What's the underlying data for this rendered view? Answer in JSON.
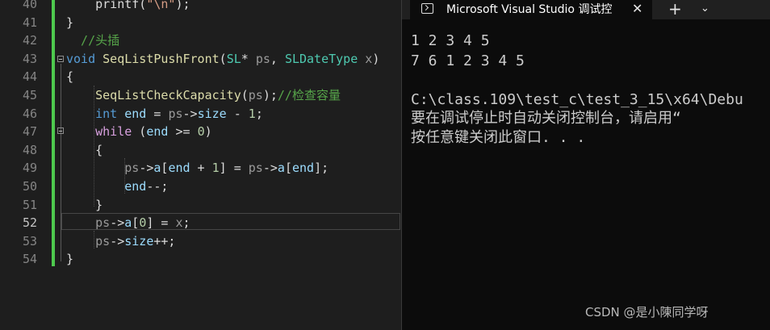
{
  "editor": {
    "lines": [
      {
        "num": "40",
        "tokens": [
          {
            "t": "    printf(",
            "c": "pl"
          },
          {
            "t": "\"\\n\"",
            "c": "st"
          },
          {
            "t": ");",
            "c": "pl"
          }
        ]
      },
      {
        "num": "41",
        "tokens": [
          {
            "t": "}",
            "c": "pl"
          }
        ]
      },
      {
        "num": "42",
        "tokens": [
          {
            "t": "  //头插",
            "c": "cm"
          }
        ]
      },
      {
        "num": "43",
        "tokens": [
          {
            "t": "void",
            "c": "kw"
          },
          {
            "t": " ",
            "c": "pl"
          },
          {
            "t": "SeqListPushFront",
            "c": "fn"
          },
          {
            "t": "(",
            "c": "pl"
          },
          {
            "t": "SL",
            "c": "ty"
          },
          {
            "t": "* ",
            "c": "pl"
          },
          {
            "t": "ps",
            "c": "pm"
          },
          {
            "t": ", ",
            "c": "pl"
          },
          {
            "t": "SLDateType",
            "c": "ty"
          },
          {
            "t": " ",
            "c": "pl"
          },
          {
            "t": "x",
            "c": "pm"
          },
          {
            "t": ")",
            "c": "pl"
          }
        ]
      },
      {
        "num": "44",
        "tokens": [
          {
            "t": "{",
            "c": "pl"
          }
        ]
      },
      {
        "num": "45",
        "tokens": [
          {
            "t": "    ",
            "c": "pl"
          },
          {
            "t": "SeqListCheckCapacity",
            "c": "fn"
          },
          {
            "t": "(",
            "c": "pl"
          },
          {
            "t": "ps",
            "c": "pm"
          },
          {
            "t": ");",
            "c": "pl"
          },
          {
            "t": "//检查容量",
            "c": "cm"
          }
        ]
      },
      {
        "num": "46",
        "tokens": [
          {
            "t": "    ",
            "c": "pl"
          },
          {
            "t": "int",
            "c": "kw"
          },
          {
            "t": " ",
            "c": "pl"
          },
          {
            "t": "end",
            "c": "var"
          },
          {
            "t": " = ",
            "c": "pl"
          },
          {
            "t": "ps",
            "c": "pm"
          },
          {
            "t": "->",
            "c": "pl"
          },
          {
            "t": "size",
            "c": "var"
          },
          {
            "t": " - ",
            "c": "pl"
          },
          {
            "t": "1",
            "c": "nm"
          },
          {
            "t": ";",
            "c": "pl"
          }
        ]
      },
      {
        "num": "47",
        "tokens": [
          {
            "t": "    ",
            "c": "pl"
          },
          {
            "t": "while",
            "c": "kw2"
          },
          {
            "t": " (",
            "c": "pl"
          },
          {
            "t": "end",
            "c": "var"
          },
          {
            "t": " >= ",
            "c": "pl"
          },
          {
            "t": "0",
            "c": "nm"
          },
          {
            "t": ")",
            "c": "pl"
          }
        ]
      },
      {
        "num": "48",
        "tokens": [
          {
            "t": "    {",
            "c": "pl"
          }
        ]
      },
      {
        "num": "49",
        "tokens": [
          {
            "t": "        ",
            "c": "pl"
          },
          {
            "t": "ps",
            "c": "pm"
          },
          {
            "t": "->",
            "c": "pl"
          },
          {
            "t": "a",
            "c": "var"
          },
          {
            "t": "[",
            "c": "pl"
          },
          {
            "t": "end",
            "c": "var"
          },
          {
            "t": " + ",
            "c": "pl"
          },
          {
            "t": "1",
            "c": "nm"
          },
          {
            "t": "] = ",
            "c": "pl"
          },
          {
            "t": "ps",
            "c": "pm"
          },
          {
            "t": "->",
            "c": "pl"
          },
          {
            "t": "a",
            "c": "var"
          },
          {
            "t": "[",
            "c": "pl"
          },
          {
            "t": "end",
            "c": "var"
          },
          {
            "t": "];",
            "c": "pl"
          }
        ]
      },
      {
        "num": "50",
        "tokens": [
          {
            "t": "        ",
            "c": "pl"
          },
          {
            "t": "end",
            "c": "var"
          },
          {
            "t": "--;",
            "c": "pl"
          }
        ]
      },
      {
        "num": "51",
        "tokens": [
          {
            "t": "    }",
            "c": "pl"
          }
        ]
      },
      {
        "num": "52",
        "tokens": [
          {
            "t": "    ",
            "c": "pl"
          },
          {
            "t": "ps",
            "c": "pm"
          },
          {
            "t": "->",
            "c": "pl"
          },
          {
            "t": "a",
            "c": "var"
          },
          {
            "t": "[",
            "c": "pl"
          },
          {
            "t": "0",
            "c": "nm"
          },
          {
            "t": "] = ",
            "c": "pl"
          },
          {
            "t": "x",
            "c": "pm"
          },
          {
            "t": ";",
            "c": "pl"
          }
        ]
      },
      {
        "num": "53",
        "tokens": [
          {
            "t": "    ",
            "c": "pl"
          },
          {
            "t": "ps",
            "c": "pm"
          },
          {
            "t": "->",
            "c": "pl"
          },
          {
            "t": "size",
            "c": "var"
          },
          {
            "t": "++;",
            "c": "pl"
          }
        ]
      },
      {
        "num": "54",
        "tokens": [
          {
            "t": "}",
            "c": "pl"
          }
        ]
      }
    ],
    "active_line": "52",
    "colors": {
      "change_bar": "#4ec94e",
      "background": "#1e1e1e"
    }
  },
  "terminal": {
    "tab_title": "Microsoft Visual Studio 调试控",
    "tab_close": "✕",
    "tab_add": "+",
    "tab_dropdown": "⌄",
    "icon": "terminal-icon",
    "output_lines": [
      "1 2 3 4 5",
      "7 6 1 2 3 4 5",
      "",
      "C:\\class.109\\test_c\\test_3_15\\x64\\Debu",
      "要在调试停止时自动关闭控制台，请启用“",
      "按任意键关闭此窗口. . ."
    ]
  },
  "watermark": "CSDN @是小陳同学呀"
}
